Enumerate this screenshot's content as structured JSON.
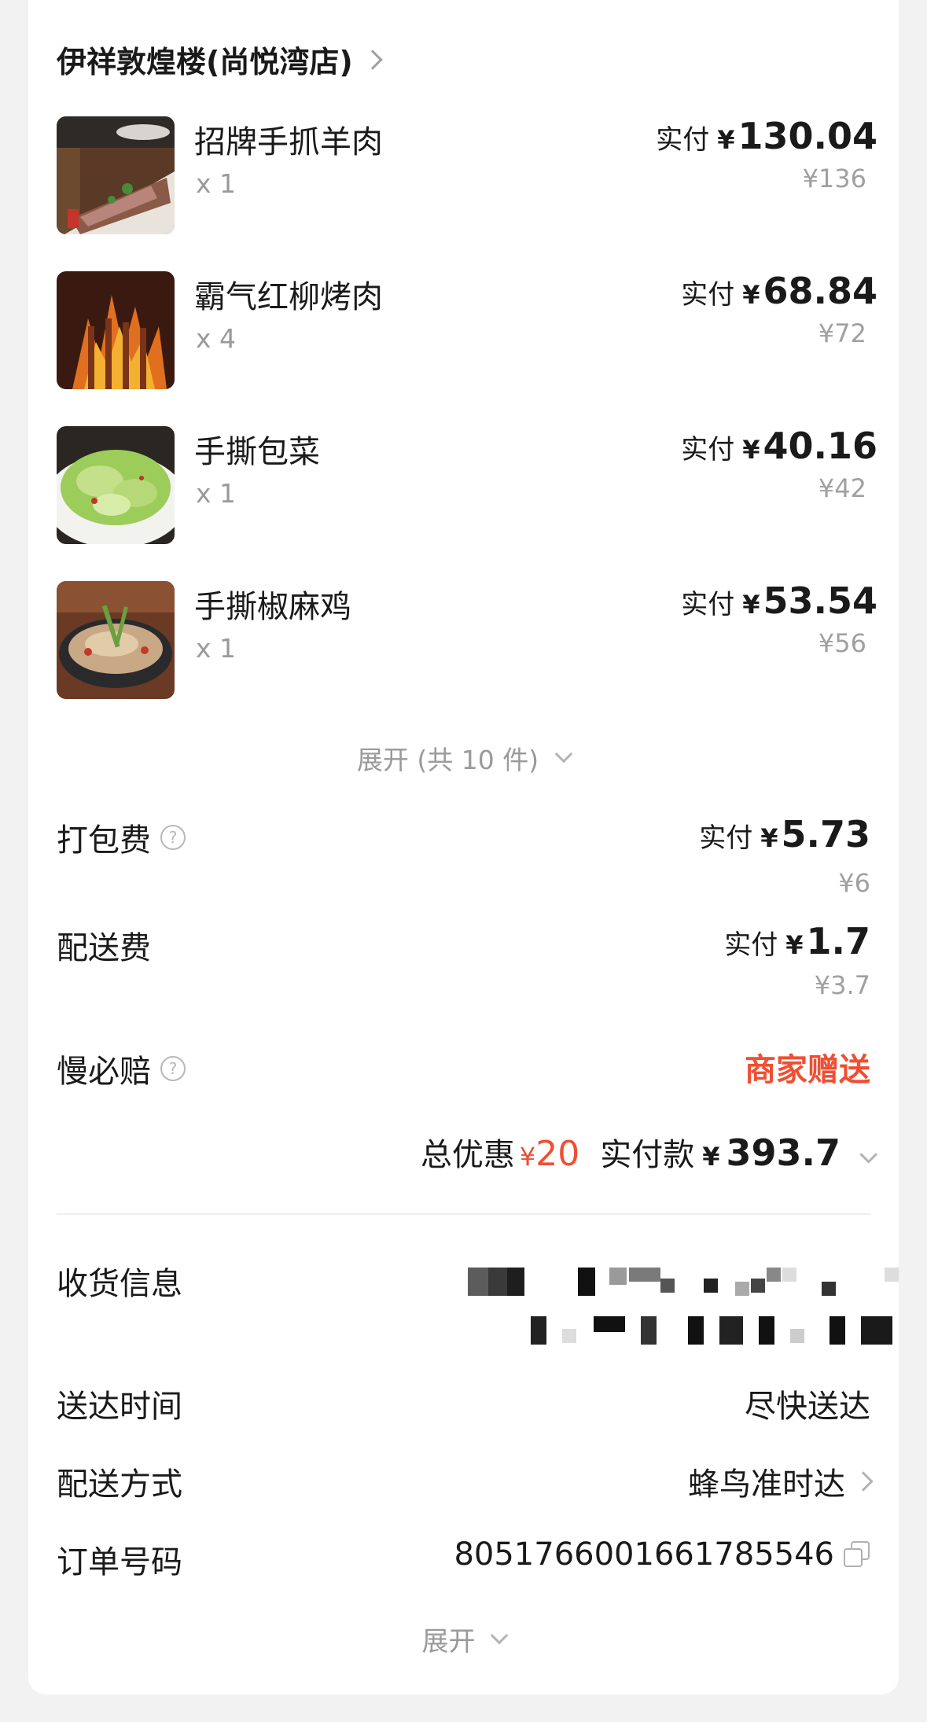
{
  "store": {
    "name": "伊祥敦煌楼(尚悦湾店)"
  },
  "dishes": [
    {
      "name": "招牌手抓羊肉",
      "qty": "x 1",
      "paid_label": "实付",
      "currency": "¥",
      "paid": "130.04",
      "original": "¥136",
      "image": "lamb-dish-image"
    },
    {
      "name": "霸气红柳烤肉",
      "qty": "x 4",
      "paid_label": "实付",
      "currency": "¥",
      "paid": "68.84",
      "original": "¥72",
      "image": "skewer-dish-image"
    },
    {
      "name": "手撕包菜",
      "qty": "x 1",
      "paid_label": "实付",
      "currency": "¥",
      "paid": "40.16",
      "original": "¥42",
      "image": "cabbage-dish-image"
    },
    {
      "name": "手撕椒麻鸡",
      "qty": "x 1",
      "paid_label": "实付",
      "currency": "¥",
      "paid": "53.54",
      "original": "¥56",
      "image": "chicken-dish-image"
    }
  ],
  "expand_items": {
    "label": "展开 (共 10 件)"
  },
  "fees": {
    "packing": {
      "label": "打包费",
      "paid_label": "实付",
      "currency": "¥",
      "paid": "5.73",
      "original": "¥6"
    },
    "delivery": {
      "label": "配送费",
      "paid_label": "实付",
      "currency": "¥",
      "paid": "1.7",
      "original": "¥3.7"
    },
    "late_compensation": {
      "label": "慢必赔",
      "value": "商家赠送"
    }
  },
  "totals": {
    "discount_label": "总优惠",
    "discount_currency": "¥",
    "discount": "20",
    "paid_label": "实付款",
    "paid_currency": "¥",
    "paid": "393.7"
  },
  "info": {
    "address_label": "收货信息",
    "time_label": "送达时间",
    "time_value": "尽快送达",
    "method_label": "配送方式",
    "method_value": "蜂鸟准时达",
    "order_label": "订单号码",
    "order_value": "8051766001661785546"
  },
  "expand_bottom": {
    "label": "展开"
  },
  "colors": {
    "accent_red": "#ef4f33",
    "muted": "#9a9a9a",
    "text": "#1a1a1a"
  }
}
